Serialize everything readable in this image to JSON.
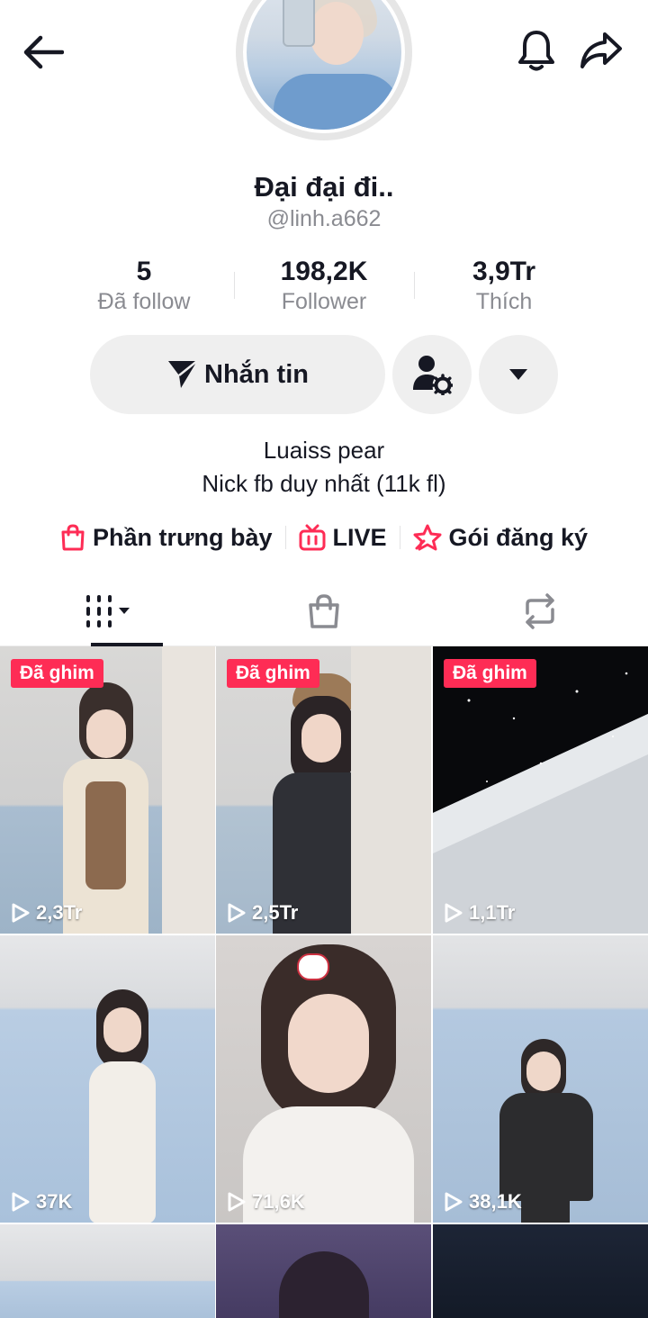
{
  "profile": {
    "display_name": "Đại đại đi..",
    "username": "@linh.a662",
    "stats": {
      "following_count": "5",
      "following_label": "Đã follow",
      "followers_count": "198,2K",
      "followers_label": "Follower",
      "likes_count": "3,9Tr",
      "likes_label": "Thích"
    },
    "bio_line1": "Luaiss pear",
    "bio_line2": "Nick fb duy nhất (11k fl)"
  },
  "actions": {
    "message_label": "Nhắn tin"
  },
  "links": {
    "showcase_label": "Phần trưng bày",
    "live_label": "LIVE",
    "subscription_label": "Gói đăng ký"
  },
  "icons": {
    "back": "back-arrow-icon",
    "bell": "bell-icon",
    "share": "share-icon",
    "send": "send-icon",
    "friend_settings": "user-settings-icon",
    "dropdown": "caret-down-icon",
    "shop_bag": "shopping-bag-icon",
    "live_tv": "live-tv-icon",
    "subscription_star": "star-icon",
    "videos_tab": "grid-videos-icon",
    "repost_tab": "repost-icon",
    "play": "play-icon"
  },
  "colors": {
    "accent": "#fe2c55",
    "text_primary": "#161823",
    "text_secondary": "#8a8b91",
    "button_bg": "#efefef"
  },
  "videos": [
    {
      "pinned_label": "Đã ghim",
      "views": "2,3Tr"
    },
    {
      "pinned_label": "Đã ghim",
      "views": "2,5Tr"
    },
    {
      "pinned_label": "Đã ghim",
      "views": "1,1Tr"
    },
    {
      "pinned_label": "",
      "views": "37K"
    },
    {
      "pinned_label": "",
      "views": "71,6K"
    },
    {
      "pinned_label": "",
      "views": "38,1K"
    }
  ]
}
